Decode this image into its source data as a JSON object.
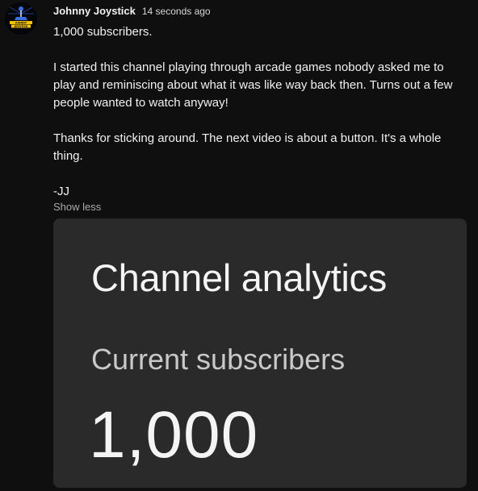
{
  "comment": {
    "author": "Johnny Joystick",
    "timestamp": "14 seconds ago",
    "avatar_icon": "joystick-logo-icon",
    "avatar_text": "JOHNNY JOYSTICK",
    "paragraphs": [
      "1,000 subscribers.",
      "I started this channel playing through arcade games nobody asked me to play and reminiscing about what it was like way back then. Turns out a few people wanted to watch anyway!",
      "Thanks for sticking around. The next video is about a button. It's a whole thing.",
      "-JJ"
    ],
    "show_less_label": "Show less"
  },
  "analytics_card": {
    "title": "Channel analytics",
    "metric_label": "Current subscribers",
    "metric_value": "1,000"
  },
  "colors": {
    "background": "#0f0f0f",
    "card_background": "#2a2a2a",
    "text_primary": "#f1f1f1",
    "text_secondary": "#aaaaaa",
    "logo_blue": "#3b6fe0",
    "logo_yellow": "#f2c200"
  }
}
